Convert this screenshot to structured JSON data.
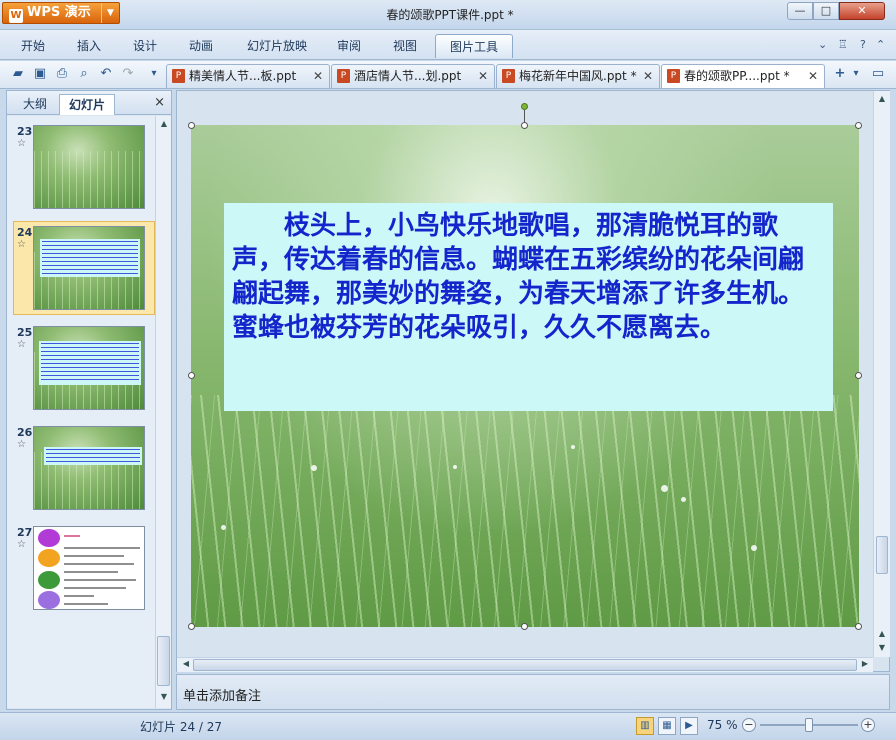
{
  "app": {
    "name": "WPS 演示",
    "doc_title": "春的颂歌PPT课件.ppt *"
  },
  "menu": {
    "tabs": [
      "开始",
      "插入",
      "设计",
      "动画",
      "幻灯片放映",
      "审阅",
      "视图",
      "图片工具"
    ],
    "active": "图片工具"
  },
  "doc_tabs": [
    {
      "label": "精美情人节...板.ppt",
      "active": false
    },
    {
      "label": "酒店情人节...划.ppt",
      "active": false
    },
    {
      "label": "梅花新年中国风.ppt *",
      "active": false
    },
    {
      "label": "春的颂歌PP....ppt *",
      "active": true
    }
  ],
  "left_panel": {
    "tab_outline": "大纲",
    "tab_slides": "幻灯片",
    "close": "×",
    "thumbnails": [
      {
        "num": "23",
        "selected": false
      },
      {
        "num": "24",
        "selected": true
      },
      {
        "num": "25",
        "selected": false
      },
      {
        "num": "26",
        "selected": false
      },
      {
        "num": "27",
        "selected": false
      }
    ],
    "star": "☆"
  },
  "slide": {
    "text": "枝头上，小鸟快乐地歌唱，那清脆悦耳的歌声，传达着春的信息。蝴蝶在五彩缤纷的花朵间翩翩起舞，那美妙的舞姿，为春天增添了许多生机。蜜蜂也被芬芳的花朵吸引，久久不愿离去。",
    "text_color": "#1326cc",
    "box_color": "#cdf8f8"
  },
  "notes": {
    "placeholder": "单击添加备注"
  },
  "status": {
    "slide_count": "幻灯片 24 / 27",
    "zoom": "75 %",
    "zoom_level": 0.5
  },
  "colors": {
    "accent": "#d9630b",
    "frame": "#c9d9ec"
  }
}
